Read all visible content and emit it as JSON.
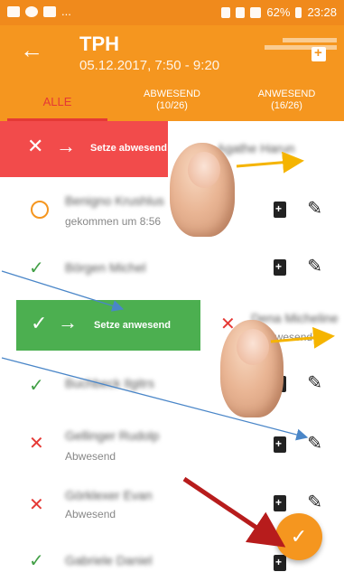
{
  "statusbar": {
    "left_text": "...",
    "battery": "62%",
    "time": "23:28"
  },
  "toolbar": {
    "back_icon": "←",
    "title": "TPH",
    "subtitle": "05.12.2017, 7:50 - 9:20"
  },
  "tabs": [
    {
      "label": "ALLE",
      "count": ""
    },
    {
      "label": "ABWESEND",
      "count": "(10/26)"
    },
    {
      "label": "ANWESEND",
      "count": "(16/26)"
    }
  ],
  "swipe_absent": {
    "label": "Setze abwesend",
    "x_icon": "✕",
    "arrow_icon": "→",
    "row_icon": "✓"
  },
  "swipe_present": {
    "label": "Setze anwesend",
    "check_icon": "✓",
    "arrow_icon": "→",
    "row_icon": "✕",
    "row_sub": "Abwesend"
  },
  "rows": [
    {
      "name": "Benigno Krushlus",
      "sub": "gekommen um 8:56",
      "status": "pending"
    },
    {
      "name": "Börgen Michel",
      "sub": "",
      "status": "present"
    },
    {
      "name": "Buchbeck Ilgitrs",
      "sub": "",
      "status": "present"
    },
    {
      "name": "Gellinger Rudolp",
      "sub": "Abwesend",
      "status": "absent"
    },
    {
      "name": "Görklexer Evan",
      "sub": "Abwesend",
      "status": "absent"
    },
    {
      "name": "Gabriele Daniel",
      "sub": "",
      "status": "present"
    }
  ],
  "swiped_row_names": [
    "Agathe Harun",
    "Dena Micheline"
  ],
  "icons": {
    "check": "✓",
    "cross": "✕",
    "pencil": "✎",
    "fab": "✓"
  },
  "colors": {
    "primary": "#f5961f",
    "absent_red": "#f24b4b",
    "present_green": "#4caf50"
  }
}
